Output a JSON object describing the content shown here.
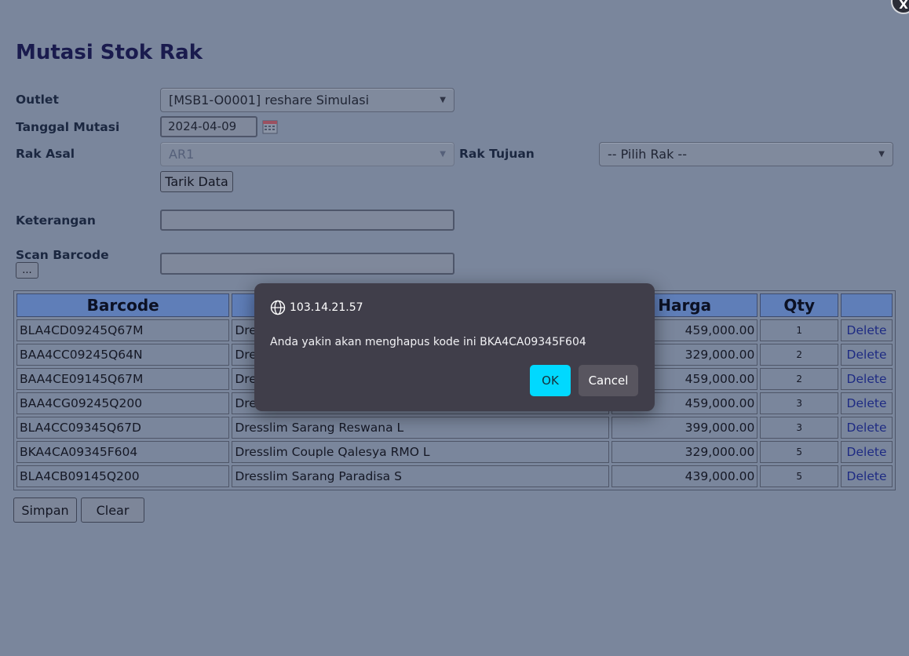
{
  "form": {
    "title": "Mutasi Stok Rak",
    "outlet_label": "Outlet",
    "outlet_value": "[MSB1-O0001] reshare Simulasi",
    "tanggal_label": "Tanggal Mutasi",
    "tanggal_value": "2024-04-09",
    "rak_asal_label": "Rak Asal",
    "rak_asal_value": "AR1",
    "rak_tujuan_label": "Rak Tujuan",
    "rak_tujuan_value": "-- Pilih Rak --",
    "tarik_data_label": "Tarik Data",
    "keterangan_label": "Keterangan",
    "keterangan_value": "",
    "scan_label": "Scan Barcode",
    "scan_button_label": "...",
    "scan_value": ""
  },
  "table": {
    "headers": [
      "Barcode",
      "",
      "Harga",
      "Qty",
      ""
    ],
    "rows": [
      {
        "barcode": "BLA4CD09245Q67M",
        "name": "Dre",
        "harga": "459,000.00",
        "qty": "1",
        "action": "Delete"
      },
      {
        "barcode": "BAA4CC09245Q64N",
        "name": "Dre",
        "harga": "329,000.00",
        "qty": "2",
        "action": "Delete"
      },
      {
        "barcode": "BAA4CE09145Q67M",
        "name": "Dre",
        "harga": "459,000.00",
        "qty": "2",
        "action": "Delete"
      },
      {
        "barcode": "BAA4CG09245Q200",
        "name": "Dre",
        "harga": "459,000.00",
        "qty": "3",
        "action": "Delete"
      },
      {
        "barcode": "BLA4CC09345Q67D",
        "name": "Dresslim Sarang Reswana L",
        "harga": "399,000.00",
        "qty": "3",
        "action": "Delete"
      },
      {
        "barcode": "BKA4CA09345F604",
        "name": "Dresslim Couple Qalesya RMO L",
        "harga": "329,000.00",
        "qty": "5",
        "action": "Delete"
      },
      {
        "barcode": "BLA4CB09145Q200",
        "name": "Dresslim Sarang Paradisa S",
        "harga": "439,000.00",
        "qty": "5",
        "action": "Delete"
      }
    ]
  },
  "actions": {
    "simpan_label": "Simpan",
    "clear_label": "Clear"
  },
  "window": {
    "close_label": "X"
  },
  "dialog": {
    "host": "103.14.21.57",
    "message": "Anda yakin akan menghapus kode ini BKA4CA09345F604",
    "ok_label": "OK",
    "cancel_label": "Cancel",
    "icon": "globe-icon"
  },
  "colors": {
    "ok_button": "#00d9ff",
    "table_header": "#5f7eb8",
    "title": "#1a1b4e"
  }
}
